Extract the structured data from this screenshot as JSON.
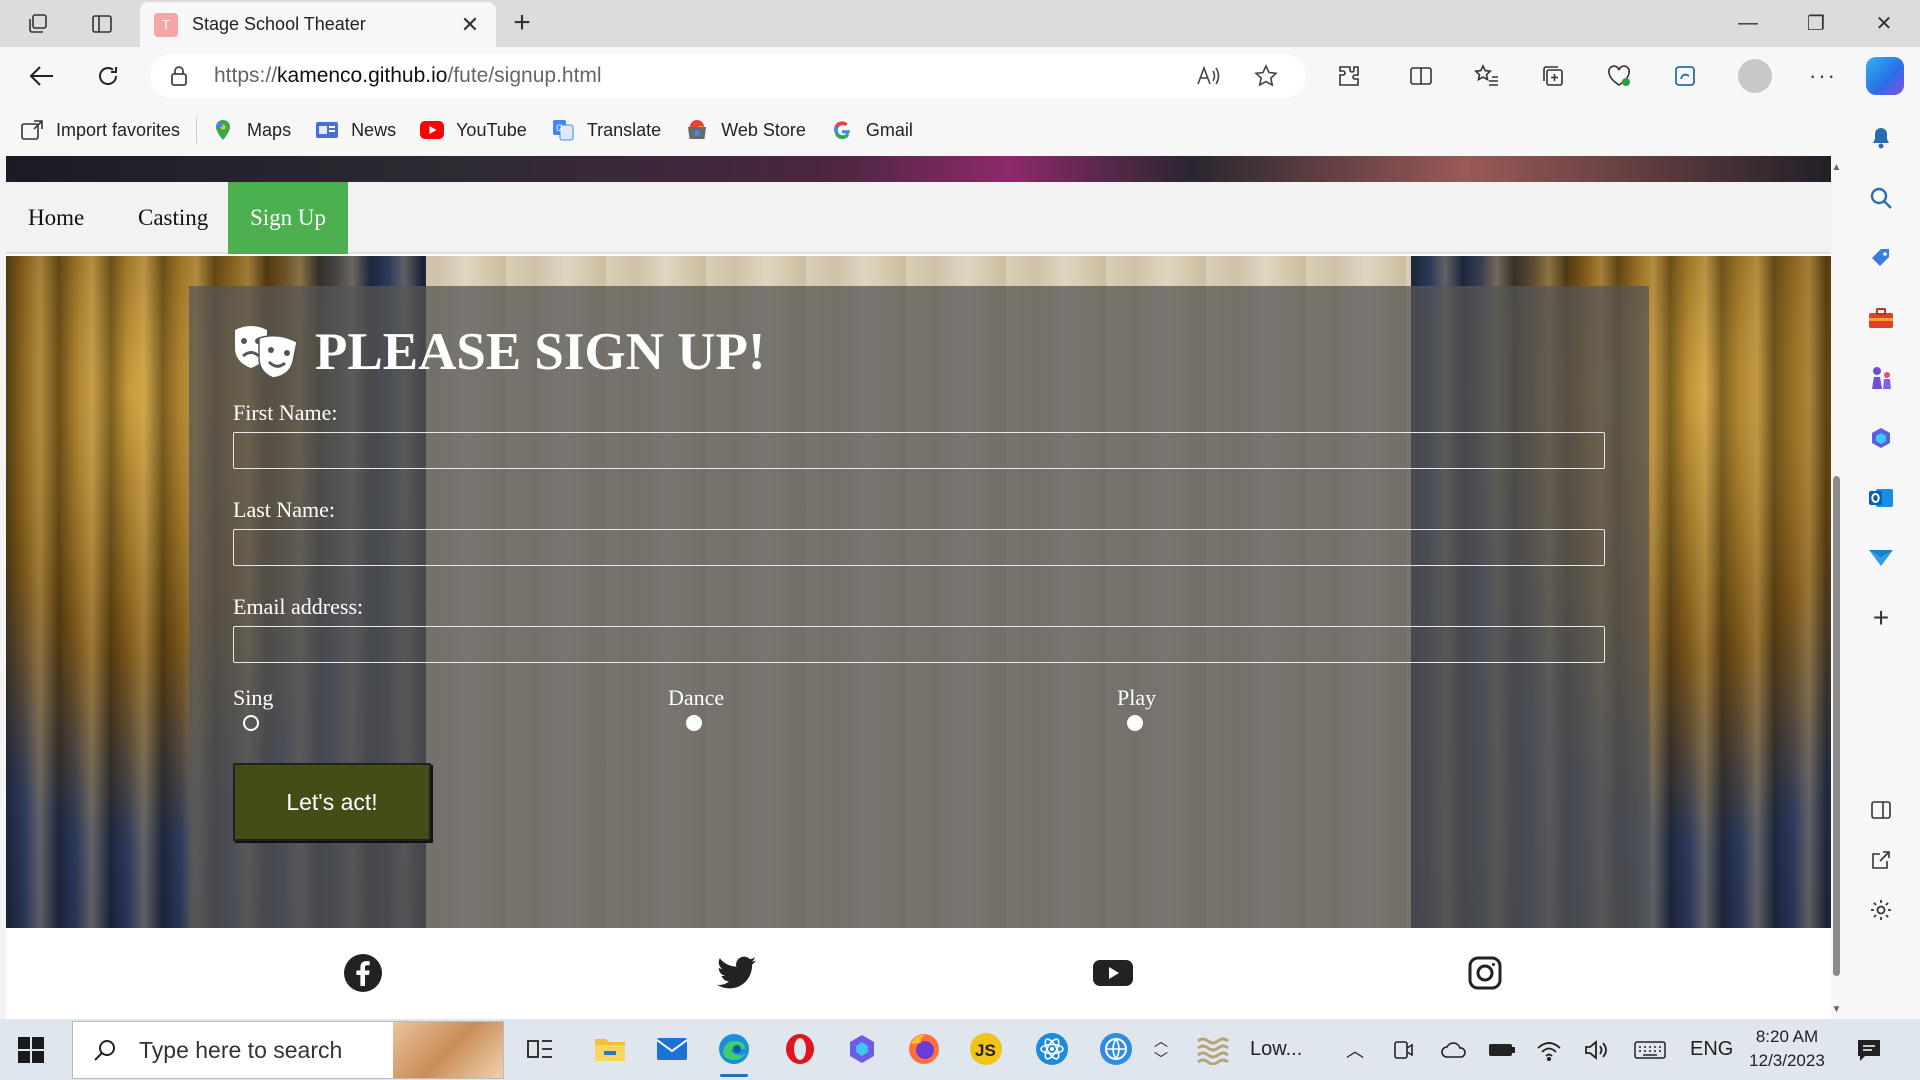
{
  "browser": {
    "tab_title": "Stage School Theater",
    "url_prefix": "https://",
    "url_domain": "kamenco.github.io",
    "url_path": "/fute/signup.html"
  },
  "bookmarks": [
    {
      "label": "Import favorites",
      "icon": "import-icon"
    },
    {
      "label": "Maps",
      "icon": "maps-icon",
      "color": "#34a853"
    },
    {
      "label": "News",
      "icon": "news-icon",
      "color": "#4a6fd4"
    },
    {
      "label": "YouTube",
      "icon": "youtube-icon",
      "color": "#ff0000"
    },
    {
      "label": "Translate",
      "icon": "translate-icon",
      "color": "#4285f4"
    },
    {
      "label": "Web Store",
      "icon": "webstore-icon",
      "color": "#e94235"
    },
    {
      "label": "Gmail",
      "icon": "google-icon",
      "color": "#4285f4"
    }
  ],
  "nav": {
    "home": "Home",
    "casting": "Casting",
    "signup": "Sign Up",
    "active_color": "#4caf50"
  },
  "form": {
    "title": "PLEASE SIGN UP!",
    "first_name_label": "First Name:",
    "last_name_label": "Last Name:",
    "email_label": "Email address:",
    "first_name_value": "",
    "last_name_value": "",
    "email_value": "",
    "options": [
      "Sing",
      "Dance",
      "Play"
    ],
    "submit_label": "Let's act!",
    "submit_color": "#444d16"
  },
  "footer": {
    "social": [
      "facebook-icon",
      "twitter-icon",
      "youtube-icon",
      "instagram-icon"
    ]
  },
  "taskbar": {
    "search_placeholder": "Type here to search",
    "weather_text": "Low...",
    "language": "ENG",
    "time": "8:20 AM",
    "date": "12/3/2023"
  }
}
